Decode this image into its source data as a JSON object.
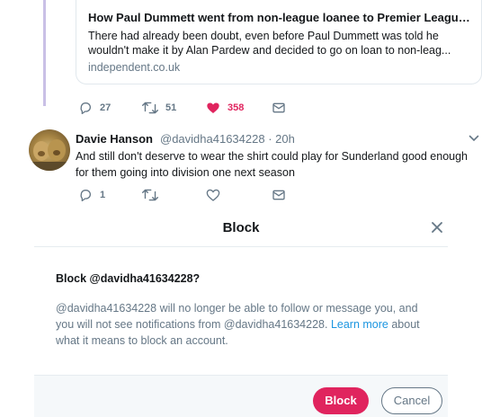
{
  "card": {
    "title": "How Paul Dummett went from non-league loanee to Premier League ...",
    "description": "There had already been doubt, even before Paul Dummett was told he wouldn't make it by Alan Pardew and decided to go on loan to non-leag...",
    "domain": "independent.co.uk"
  },
  "tweet1_actions": {
    "replies": "27",
    "retweets": "51",
    "likes": "358"
  },
  "tweet2": {
    "name": "Davie Hanson",
    "handle": "@davidha41634228",
    "time": "· 20h",
    "text": "And still don't deserve to wear the shirt could play for Sunderland good enough for them going into division one next season",
    "replies": "1"
  },
  "modal": {
    "title": "Block",
    "heading": "Block @davidha41634228?",
    "body_part1": "@davidha41634228 will no longer be able to follow or message you, and you will not see notifications from @davidha41634228. ",
    "learn_more": "Learn more",
    "body_part2": " about what it means to block an account.",
    "block_label": "Block",
    "cancel_label": "Cancel"
  },
  "colors": {
    "like": "#e0245e",
    "link": "#1b95e0",
    "muted": "#657786",
    "block_button": "#e0245e"
  },
  "icons": [
    "reply-icon",
    "retweet-icon",
    "heart-icon",
    "mail-icon",
    "close-icon",
    "chevron-down-icon"
  ]
}
